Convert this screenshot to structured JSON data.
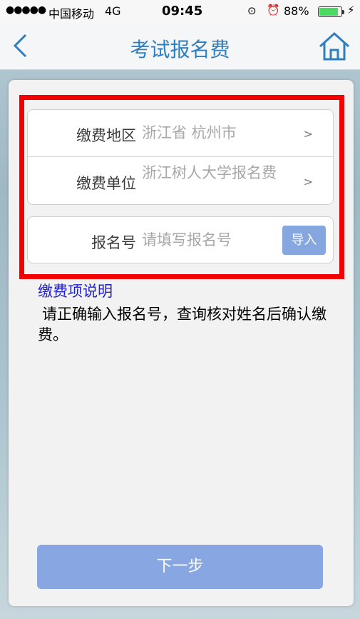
{
  "status_bar": {
    "signal": "●●●●●",
    "carrier": "中国移动",
    "network": "4G",
    "time": "09:45",
    "battery_percent": "88%",
    "battery_level": 0.88
  },
  "nav": {
    "title": "考试报名费",
    "back_icon": "chevron-left-icon",
    "home_icon": "home-icon"
  },
  "form": {
    "region_label": "缴费地区",
    "region_value": "浙江省 杭州市",
    "unit_label": "缴费单位",
    "unit_value": "浙江树人大学报名费",
    "reg_no_label": "报名号",
    "reg_no_placeholder": "请填写报名号",
    "import_label": "导入"
  },
  "description": {
    "title": "缴费项说明",
    "body": "请正确输入报名号，查询核对姓名后确认缴费。"
  },
  "next_button": "下一步",
  "colors": {
    "accent": "#2f7ec0",
    "button": "#87a6e2",
    "highlight": "#f40000"
  }
}
